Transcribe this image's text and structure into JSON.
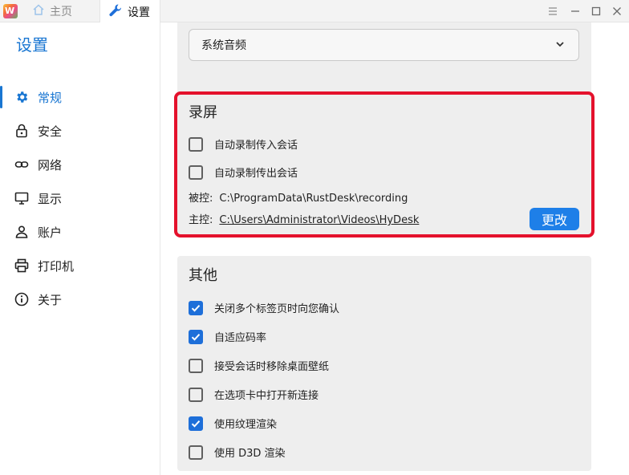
{
  "tabs": {
    "home_label": "主页",
    "settings_label": "设置"
  },
  "app_logo_text": "W",
  "sidebar": {
    "title": "设置",
    "items": [
      {
        "label": "常规",
        "icon": "gear-icon",
        "active": true
      },
      {
        "label": "安全",
        "icon": "lock-icon",
        "active": false
      },
      {
        "label": "网络",
        "icon": "link-icon",
        "active": false
      },
      {
        "label": "显示",
        "icon": "monitor-icon",
        "active": false
      },
      {
        "label": "账户",
        "icon": "person-icon",
        "active": false
      },
      {
        "label": "打印机",
        "icon": "printer-icon",
        "active": false
      },
      {
        "label": "关于",
        "icon": "info-icon",
        "active": false
      }
    ]
  },
  "audio": {
    "selected": "系统音频"
  },
  "recording": {
    "title": "录屏",
    "options": [
      {
        "label": "自动录制传入会话",
        "checked": false
      },
      {
        "label": "自动录制传出会话",
        "checked": false
      }
    ],
    "controlled_label": "被控:",
    "controlled_path": "C:\\ProgramData\\RustDesk\\recording",
    "controller_label": "主控:",
    "controller_path": "C:\\Users\\Administrator\\Videos\\HyDesk",
    "change_button": "更改"
  },
  "other": {
    "title": "其他",
    "options": [
      {
        "label": "关闭多个标签页时向您确认",
        "checked": true
      },
      {
        "label": "自适应码率",
        "checked": true
      },
      {
        "label": "接受会话时移除桌面壁纸",
        "checked": false
      },
      {
        "label": "在选项卡中打开新连接",
        "checked": false
      },
      {
        "label": "使用纹理渲染",
        "checked": true
      },
      {
        "label": "使用 D3D 渲染",
        "checked": false
      }
    ]
  },
  "colors": {
    "accent": "#1976d2",
    "highlight_border": "#e4112c",
    "checkbox_on": "#1e6fd9"
  }
}
